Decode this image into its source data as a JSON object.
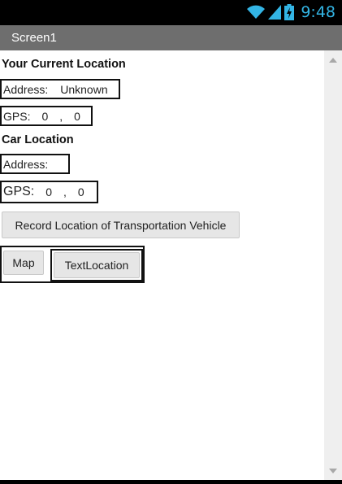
{
  "status_bar": {
    "time": "9:48",
    "wifi_icon": "wifi-icon",
    "signal_icon": "signal-icon",
    "battery_icon": "battery-charging-icon",
    "accent_color": "#33b5e5"
  },
  "title_bar": {
    "title": "Screen1"
  },
  "current_location": {
    "heading": "Your Current Location",
    "address_label": "Address:",
    "address_value": "Unknown",
    "gps_label": "GPS:",
    "gps_lat": "0",
    "gps_sep": ",",
    "gps_lon": "0"
  },
  "car_location": {
    "heading": "Car Location",
    "address_label": "Address:",
    "gps_label": "GPS:",
    "gps_lat": "0",
    "gps_sep": ",",
    "gps_lon": "0"
  },
  "buttons": {
    "record": "Record Location of Transportation Vehicle",
    "map": "Map",
    "text_location": "TextLocation"
  }
}
